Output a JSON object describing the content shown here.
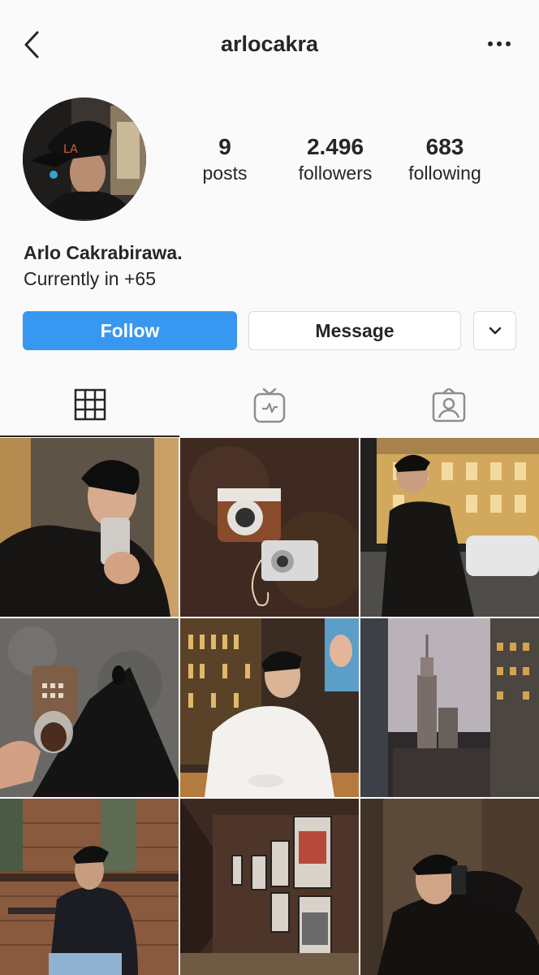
{
  "header": {
    "username": "arlocakra",
    "back_icon": "chevron-left-icon",
    "more_icon": "more-horizontal-icon"
  },
  "stats": [
    {
      "value": "9",
      "label": "posts"
    },
    {
      "value": "2.496",
      "label": "followers"
    },
    {
      "value": "683",
      "label": "following"
    }
  ],
  "bio": {
    "name": "Arlo Cakrabirawa.",
    "text": "Currently in +65"
  },
  "actions": {
    "follow": "Follow",
    "message": "Message",
    "more_icon": "chevron-down-icon"
  },
  "tabs": [
    {
      "icon": "grid-icon",
      "active": true
    },
    {
      "icon": "igtv-icon",
      "active": false
    },
    {
      "icon": "tagged-icon",
      "active": false
    }
  ],
  "colors": {
    "accent": "#3897f0",
    "text": "#262626",
    "background": "#fafafa",
    "border": "#dbdbdb"
  },
  "posts": [
    {
      "name": "post-mirror-selfie"
    },
    {
      "name": "post-cameras"
    },
    {
      "name": "post-street-night"
    },
    {
      "name": "post-coffee"
    },
    {
      "name": "post-restaurant"
    },
    {
      "name": "post-skyline"
    },
    {
      "name": "post-brick-cafe"
    },
    {
      "name": "post-gallery-hallway"
    },
    {
      "name": "post-dark-selfie"
    }
  ]
}
